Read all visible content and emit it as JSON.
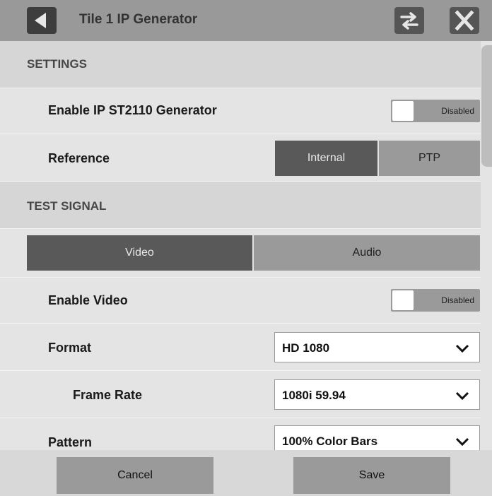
{
  "header": {
    "title": "Tile 1 IP Generator",
    "back_icon": "back-arrow-icon",
    "swap_icon": "swap-arrows-icon",
    "close_icon": "close-x-icon"
  },
  "settings": {
    "heading": "SETTINGS",
    "enable_generator": {
      "label": "Enable IP ST2110 Generator",
      "state": "Disabled"
    },
    "reference": {
      "label": "Reference",
      "options": [
        "Internal",
        "PTP"
      ],
      "selected": "Internal"
    }
  },
  "test_signal": {
    "heading": "TEST SIGNAL",
    "tabs": [
      "Video",
      "Audio"
    ],
    "selected_tab": "Video",
    "enable_video": {
      "label": "Enable Video",
      "state": "Disabled"
    },
    "format": {
      "label": "Format",
      "value": "HD 1080"
    },
    "frame_rate": {
      "label": "Frame Rate",
      "value": "1080i 59.94"
    },
    "pattern": {
      "label": "Pattern",
      "value": "100% Color Bars"
    }
  },
  "footer": {
    "cancel_label": "Cancel",
    "save_label": "Save"
  },
  "colors": {
    "header": "#999999",
    "active_segment": "#595959",
    "inactive_segment": "#9a9a9a",
    "panel": "#e4e4e4"
  }
}
